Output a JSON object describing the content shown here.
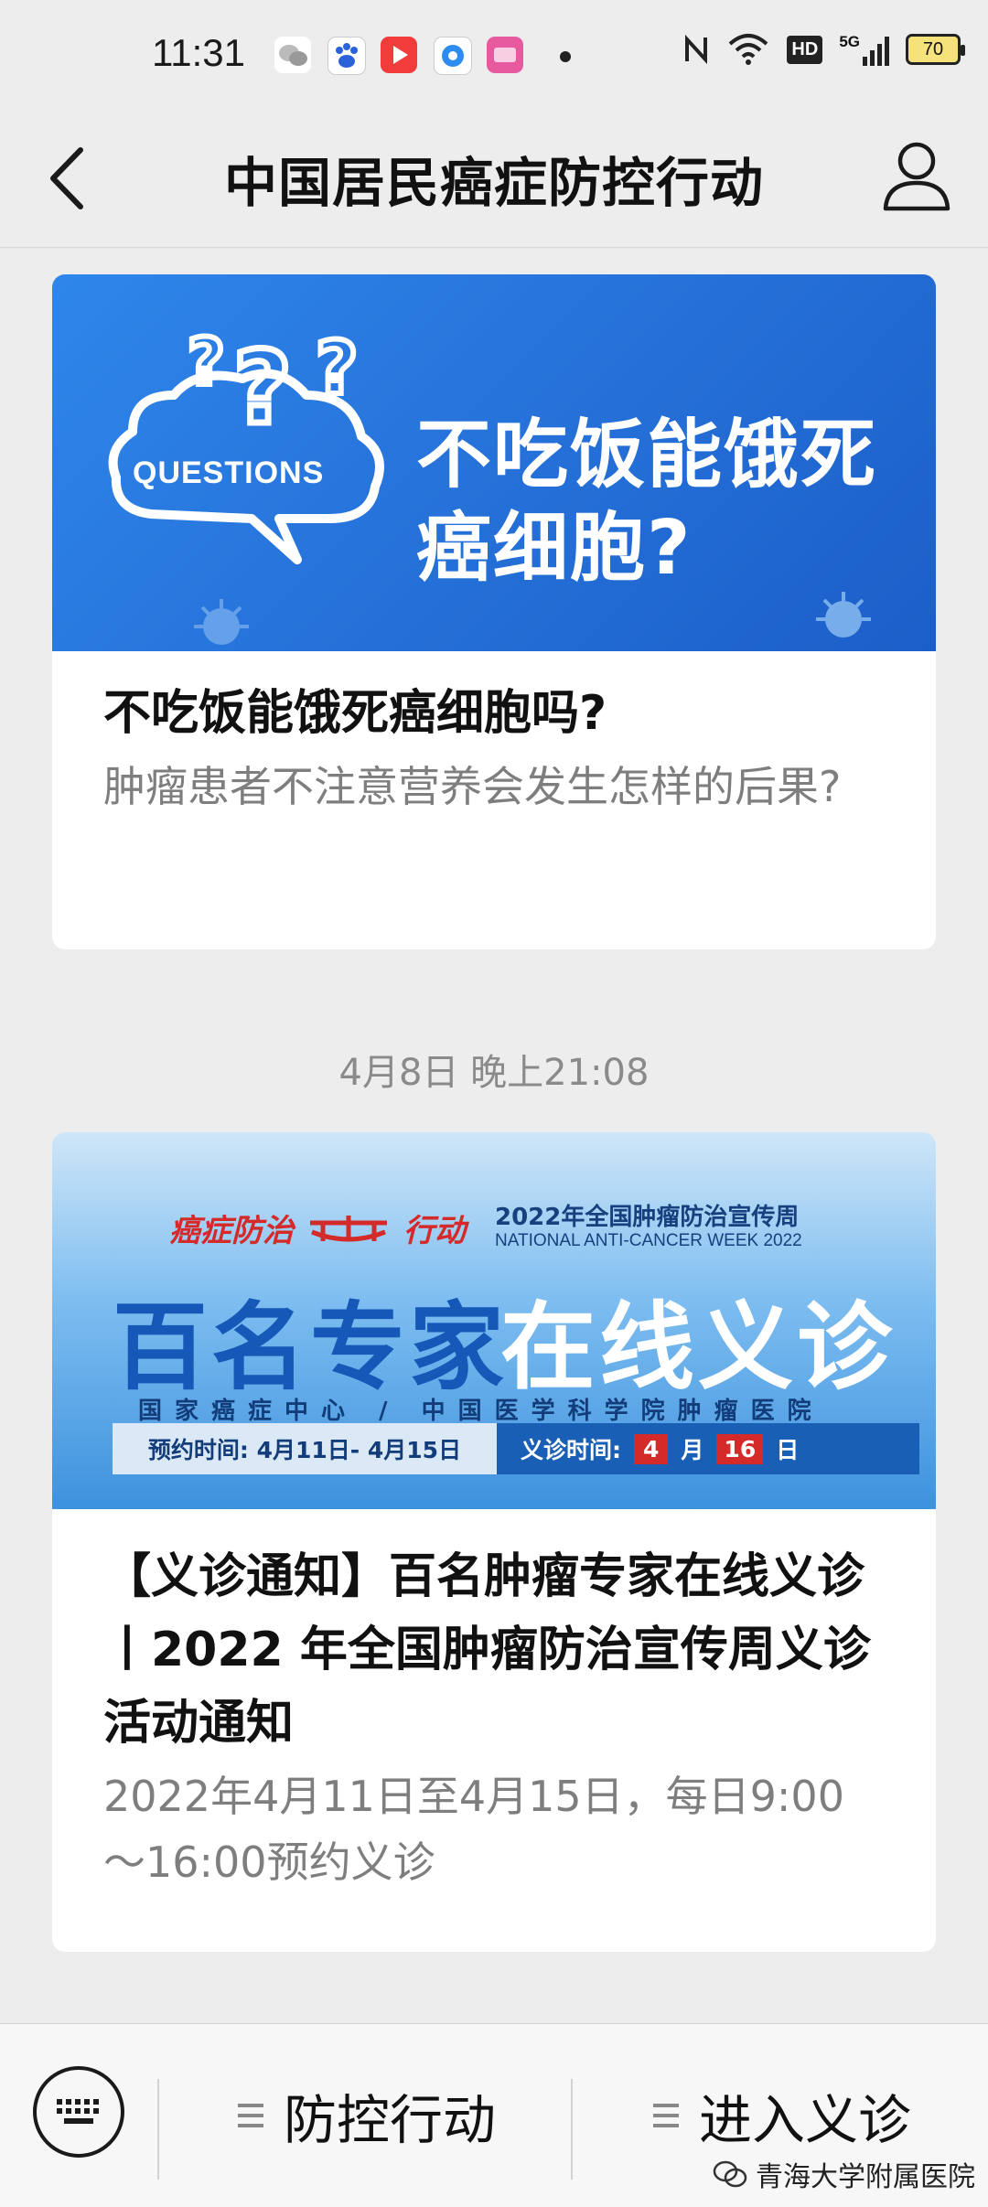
{
  "status_bar": {
    "time": "11:31",
    "battery": "70",
    "network": "5G",
    "hd": "HD"
  },
  "nav": {
    "title": "中国居民癌症防控行动"
  },
  "articles": [
    {
      "banner": {
        "cloud_label": "QUESTIONS",
        "headline_line1": "不吃饭能饿死",
        "headline_line2": "癌细胞?"
      },
      "title": "不吃饭能饿死癌细胞吗?",
      "summary": "肿瘤患者不注意营养会发生怎样的后果?"
    },
    {
      "timestamp": "4月8日 晚上21:08",
      "banner": {
        "brand": "癌症防治",
        "brand_action": "行动",
        "week_cn": "2022年全国肿瘤防治宣传周",
        "week_en": "NATIONAL ANTI-CANCER WEEK 2022",
        "headline_left": "百名专家",
        "headline_right": "在线义诊",
        "orgs": "国家癌症中心 / 中国医学科学院肿瘤医院",
        "booking": "预约时间: 4月11日- 4月15日",
        "clinic_label": "义诊时间:",
        "clinic_month": "4",
        "clinic_month_unit": "月",
        "clinic_day": "16",
        "clinic_day_unit": "日"
      },
      "title": "【义诊通知】百名肿瘤专家在线义诊丨2022 年全国肿瘤防治宣传周义诊活动通知",
      "summary": "2022年4月11日至4月15日，每日9:00～16:00预约义诊"
    }
  ],
  "bottom_bar": {
    "menu1": "防控行动",
    "menu2": "进入义诊",
    "watermark": "青海大学附属医院"
  },
  "colors": {
    "banner1": "#1f6fd6",
    "banner2": "#2a8ad9",
    "accent_red": "#d42a2a"
  }
}
